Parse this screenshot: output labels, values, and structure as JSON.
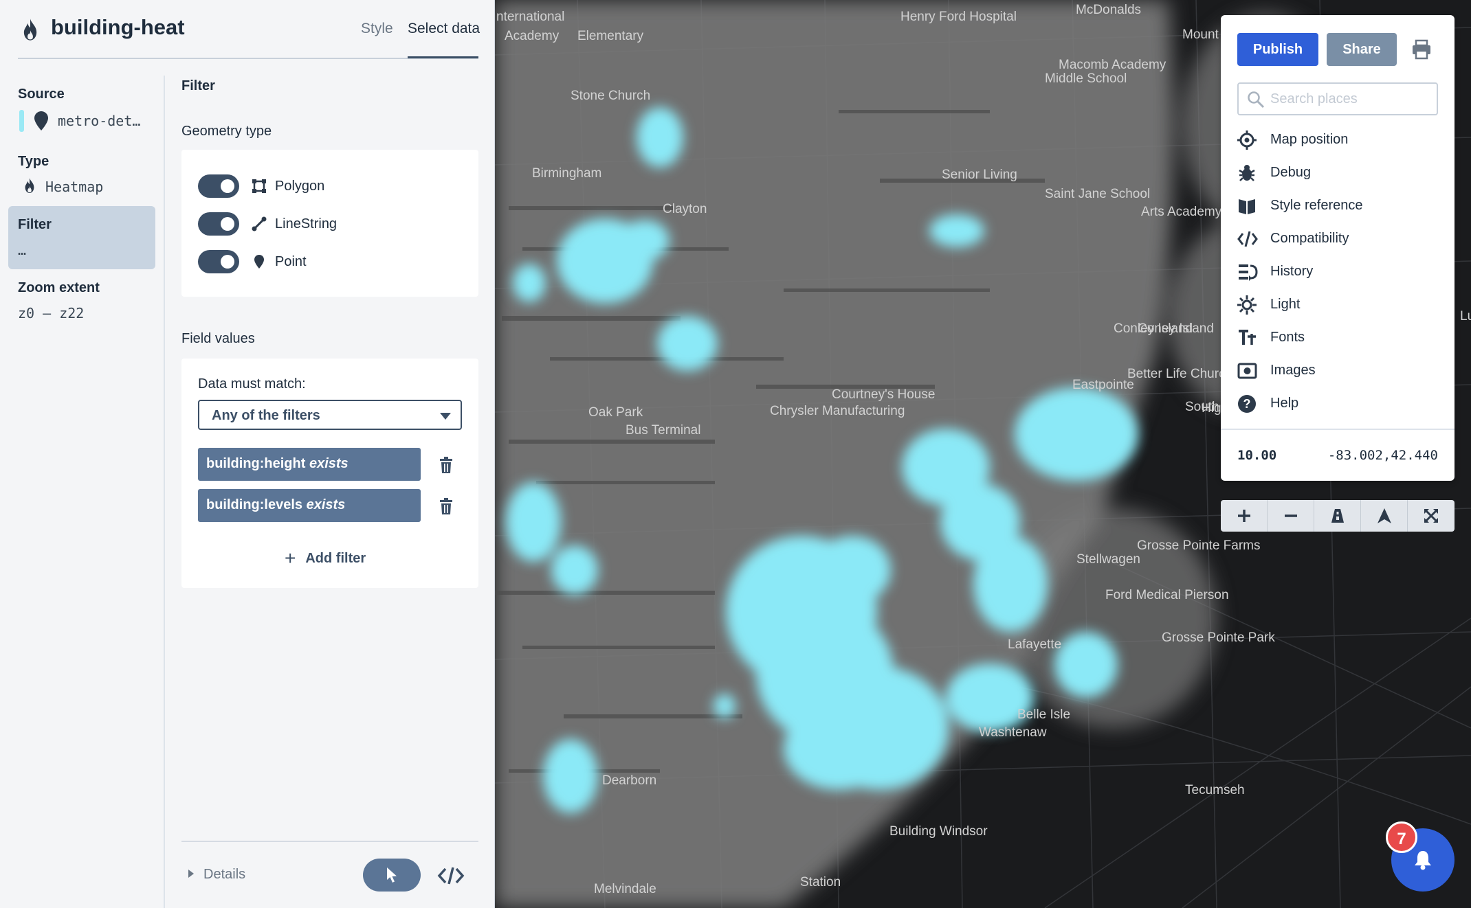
{
  "header": {
    "layer_title": "building-heat",
    "tabs": [
      "Style",
      "Select data"
    ],
    "active_tab": "Select data"
  },
  "sidebar": {
    "source_label": "Source",
    "source_value": "metro-det…",
    "source_color": "#9ae9f5",
    "type_label": "Type",
    "type_value": "Heatmap",
    "filter_label": "Filter",
    "filter_value": "…",
    "zoom_label": "Zoom extent",
    "zoom_value": "z0 – z22"
  },
  "filter_panel": {
    "heading": "Filter",
    "geometry_heading": "Geometry type",
    "geometry_types": [
      {
        "label": "Polygon",
        "enabled": true,
        "icon": "polygon-icon"
      },
      {
        "label": "LineString",
        "enabled": true,
        "icon": "linestring-icon"
      },
      {
        "label": "Point",
        "enabled": true,
        "icon": "point-icon"
      }
    ],
    "field_values_heading": "Field values",
    "match_label": "Data must match:",
    "match_value": "Any of the filters",
    "filters": [
      {
        "field": "building:height",
        "op": "exists"
      },
      {
        "field": "building:levels",
        "op": "exists"
      }
    ],
    "add_filter_label": "Add filter",
    "details_label": "Details"
  },
  "toolbar": {
    "publish_label": "Publish",
    "share_label": "Share",
    "print_icon": "print-icon",
    "search_placeholder": "Search places",
    "menu_items": [
      {
        "label": "Map position",
        "icon": "crosshair-icon"
      },
      {
        "label": "Debug",
        "icon": "bug-icon"
      },
      {
        "label": "Style reference",
        "icon": "book-icon"
      },
      {
        "label": "Compatibility",
        "icon": "code-icon"
      },
      {
        "label": "History",
        "icon": "history-icon"
      },
      {
        "label": "Light",
        "icon": "sun-icon"
      },
      {
        "label": "Fonts",
        "icon": "fonts-icon"
      },
      {
        "label": "Images",
        "icon": "images-icon"
      },
      {
        "label": "Help",
        "icon": "help-icon"
      }
    ],
    "zoom_readout": "10.00",
    "coord_readout": "-83.002,42.440"
  },
  "map_controls": [
    "zoom-in-icon",
    "zoom-out-icon",
    "pitch-icon",
    "compass-icon",
    "fullscreen-icon"
  ],
  "notification_count": "7",
  "colors": {
    "accent": "#2f5fd8",
    "heat": "#8be9f7",
    "map_bg": "#1a1b1d",
    "chip": "#5b7596",
    "badge": "#e84a4a"
  },
  "map_labels": [
    "nternational",
    "Academy",
    "Elementary",
    "Henry Ford Hospital",
    "McDonalds",
    "Mount",
    "Macomb Academy",
    "Middle School",
    "Stone Church",
    "Birmingham",
    "Senior Living",
    "Saint Jane School",
    "Arts Academy",
    "Eastpointe",
    "South Lake High School",
    "Conley Island",
    "Oak Park",
    "Bus Terminal",
    "Grosse Pointe Farms",
    "Stellwagen",
    "Dearborn",
    "Building Windsor",
    "Tecumseh",
    "Station",
    "Melvindale",
    "Grosse Pointe Park",
    "Belle Isle",
    "Lafayette",
    "Washtenaw",
    "Better Life Church",
    "High Schoo",
    "Coney Island",
    "Ford Medical Pierson",
    "Clayton",
    "Courtney's House",
    "Chrysler Manufacturing",
    "Lu"
  ]
}
